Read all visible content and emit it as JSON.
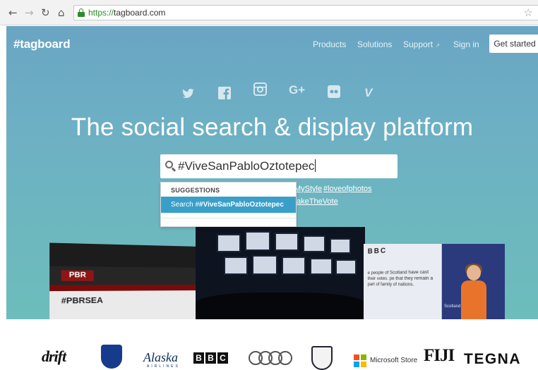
{
  "browser": {
    "url_scheme": "https://",
    "url_host": "tagboard.com"
  },
  "header": {
    "logo": "#tagboard",
    "nav": [
      "Products",
      "Solutions",
      "Support",
      "Sign in"
    ],
    "cta": "Get started"
  },
  "social_icons": [
    "twitter-icon",
    "facebook-icon",
    "instagram-icon",
    "google-plus-icon",
    "flickr-icon",
    "vine-icon"
  ],
  "hero": {
    "headline": "The social search & display platform"
  },
  "search": {
    "value": "#ViveSanPabloOztotepec"
  },
  "suggested_tags": [
    "MyStyle",
    "#loveofphotos",
    "akeTheVote"
  ],
  "suggestions": {
    "header": "SUGGESTIONS",
    "item_prefix": "Search #",
    "item_term": "#ViveSanPabloOztotepec"
  },
  "screenshots": {
    "pbr_logo": "PBR",
    "pbr_tag": "#PBRSEA",
    "bbc_logo": "BBC",
    "bbc_text": "e people of Scotland have cast their votes. pe that they remain a part of family of nations.",
    "bbc_caption": "Scotland Decides"
  },
  "logos": {
    "drift": "drift",
    "alaska": "Alaska",
    "alaska_sub": "AIRLINES",
    "bbc": [
      "B",
      "B",
      "C"
    ],
    "microsoft": "Microsoft Store",
    "fiji": "FIJI",
    "tegna": "TEGNA"
  },
  "colors": {
    "hero_gradient": [
      "#6aa5c3",
      "#6dbdbb"
    ],
    "suggestion_highlight": "#3a9fc8",
    "secure_green": "#2d8d2d"
  }
}
